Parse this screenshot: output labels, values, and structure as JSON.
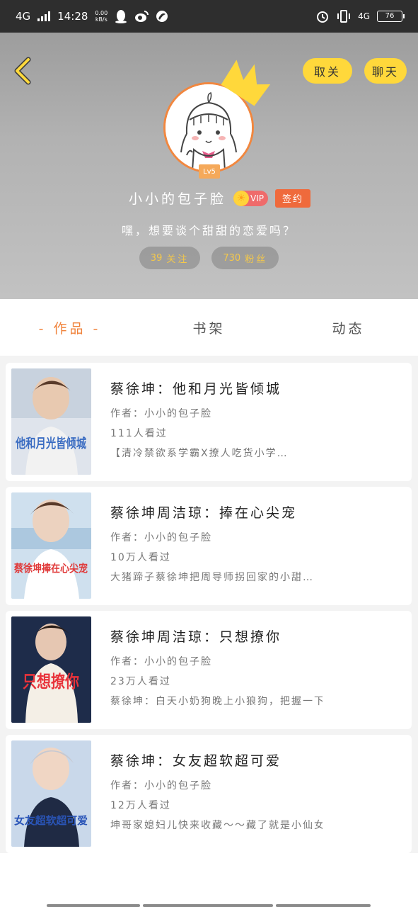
{
  "status_bar": {
    "network": "4G",
    "time": "14:28",
    "speed_value": "0.00",
    "speed_unit": "kB/s",
    "network_right": "4G",
    "battery": "76"
  },
  "header": {
    "unfollow_label": "取关",
    "chat_label": "聊天",
    "level": "Lv5",
    "username": "小小的包子脸",
    "vip_label": "VIP",
    "sign_label": "签约",
    "bio": "嘿，想要谈个甜甜的恋爱吗？",
    "following_count": "39",
    "following_label": "关注",
    "followers_count": "730",
    "followers_label": "粉丝"
  },
  "tabs": [
    {
      "label": "- 作品 -",
      "active": true
    },
    {
      "label": "书架",
      "active": false
    },
    {
      "label": "动态",
      "active": false
    }
  ],
  "works": [
    {
      "title": "蔡徐坤：他和月光皆倾城",
      "author": "作者：小小的包子脸",
      "views": "111人看过",
      "desc": "【清冷禁欲系学霸X撩人吃货小学…",
      "cover_text": "他和月光皆倾城",
      "cover_bg": "#dfe4ec",
      "cover_text_color": "#3a6cc2"
    },
    {
      "title": "蔡徐坤周洁琼：捧在心尖宠",
      "author": "作者：小小的包子脸",
      "views": "10万人看过",
      "desc": "大猪蹄子蔡徐坤把周导师拐回家的小甜…",
      "cover_text": "蔡徐坤捧在心尖宠",
      "cover_bg": "#cfe0ee",
      "cover_text_color": "#e03a3a"
    },
    {
      "title": "蔡徐坤周洁琼：只想撩你",
      "author": "作者：小小的包子脸",
      "views": "23万人看过",
      "desc": "蔡徐坤：白天小奶狗晚上小狼狗，把握一下…",
      "cover_text": "只想撩你",
      "cover_bg": "#1e2c4a",
      "cover_text_color": "#e8323a"
    },
    {
      "title": "蔡徐坤：女友超软超可爱",
      "author": "作者：小小的包子脸",
      "views": "12万人看过",
      "desc": "坤哥家媳妇儿快来收藏～～藏了就是小仙女…",
      "cover_text": "女友超软超可爱",
      "cover_bg": "#c9d8ea",
      "cover_text_color": "#2a55b8"
    }
  ],
  "colors": {
    "accent_orange": "#f0823a",
    "button_yellow": "#ffd83b",
    "vip_red": "#ef6b6b"
  }
}
